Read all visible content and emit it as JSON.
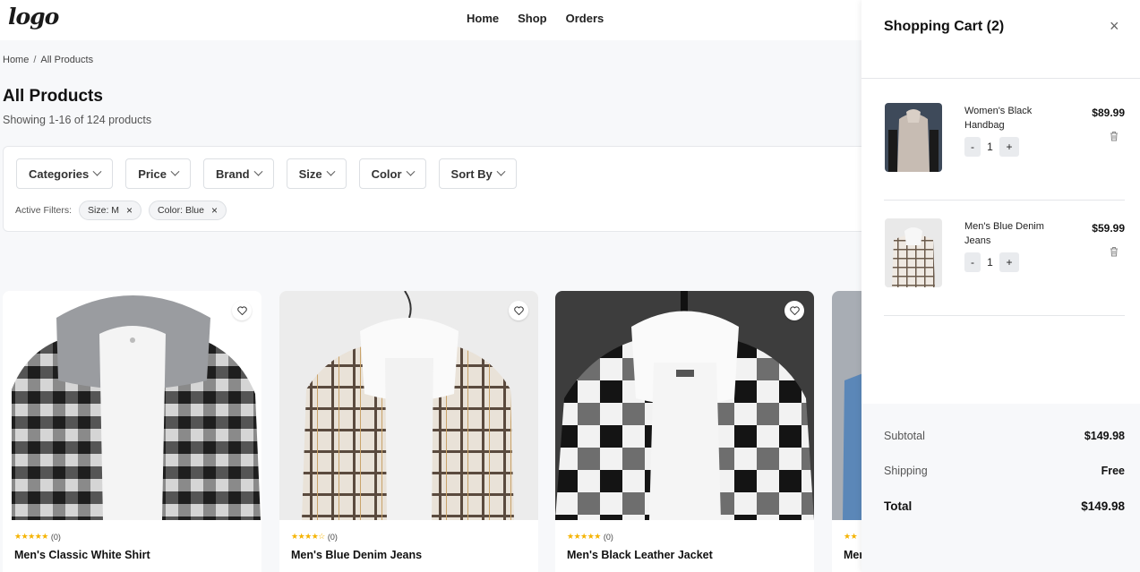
{
  "header": {
    "logo": "logo",
    "nav": [
      "Home",
      "Shop",
      "Orders"
    ]
  },
  "breadcrumb": {
    "home": "Home",
    "sep": "/",
    "current": "All Products"
  },
  "page": {
    "title": "All Products",
    "showing": "Showing 1-16 of 124 products"
  },
  "filters": {
    "buttons": [
      "Categories",
      "Price",
      "Brand",
      "Size",
      "Color",
      "Sort By"
    ],
    "active_label": "Active Filters:",
    "active": [
      "Size: M",
      "Color: Blue"
    ],
    "remove_glyph": "×"
  },
  "products": [
    {
      "name": "Men's Classic White Shirt",
      "reviews": "(0)",
      "stars": "★★★★★"
    },
    {
      "name": "Men's Blue Denim Jeans",
      "reviews": "(0)",
      "stars": "★★★★☆"
    },
    {
      "name": "Men's Black Leather Jacket",
      "reviews": "(0)",
      "stars": "★★★★★"
    },
    {
      "name": "Men",
      "reviews": "",
      "stars": "★★"
    }
  ],
  "cart": {
    "title": "Shopping Cart (2)",
    "close_glyph": "×",
    "items": [
      {
        "name": "Women's Black Handbag",
        "price": "$89.99",
        "qty": "1"
      },
      {
        "name": "Men's Blue Denim Jeans",
        "price": "$59.99",
        "qty": "1"
      }
    ],
    "minus": "-",
    "plus": "+",
    "subtotal_label": "Subtotal",
    "subtotal": "$149.98",
    "shipping_label": "Shipping",
    "shipping": "Free",
    "total_label": "Total",
    "total": "$149.98"
  },
  "colors": {
    "star": "#f5b301",
    "panel": "#ffffff",
    "background": "#f7f8fa"
  }
}
